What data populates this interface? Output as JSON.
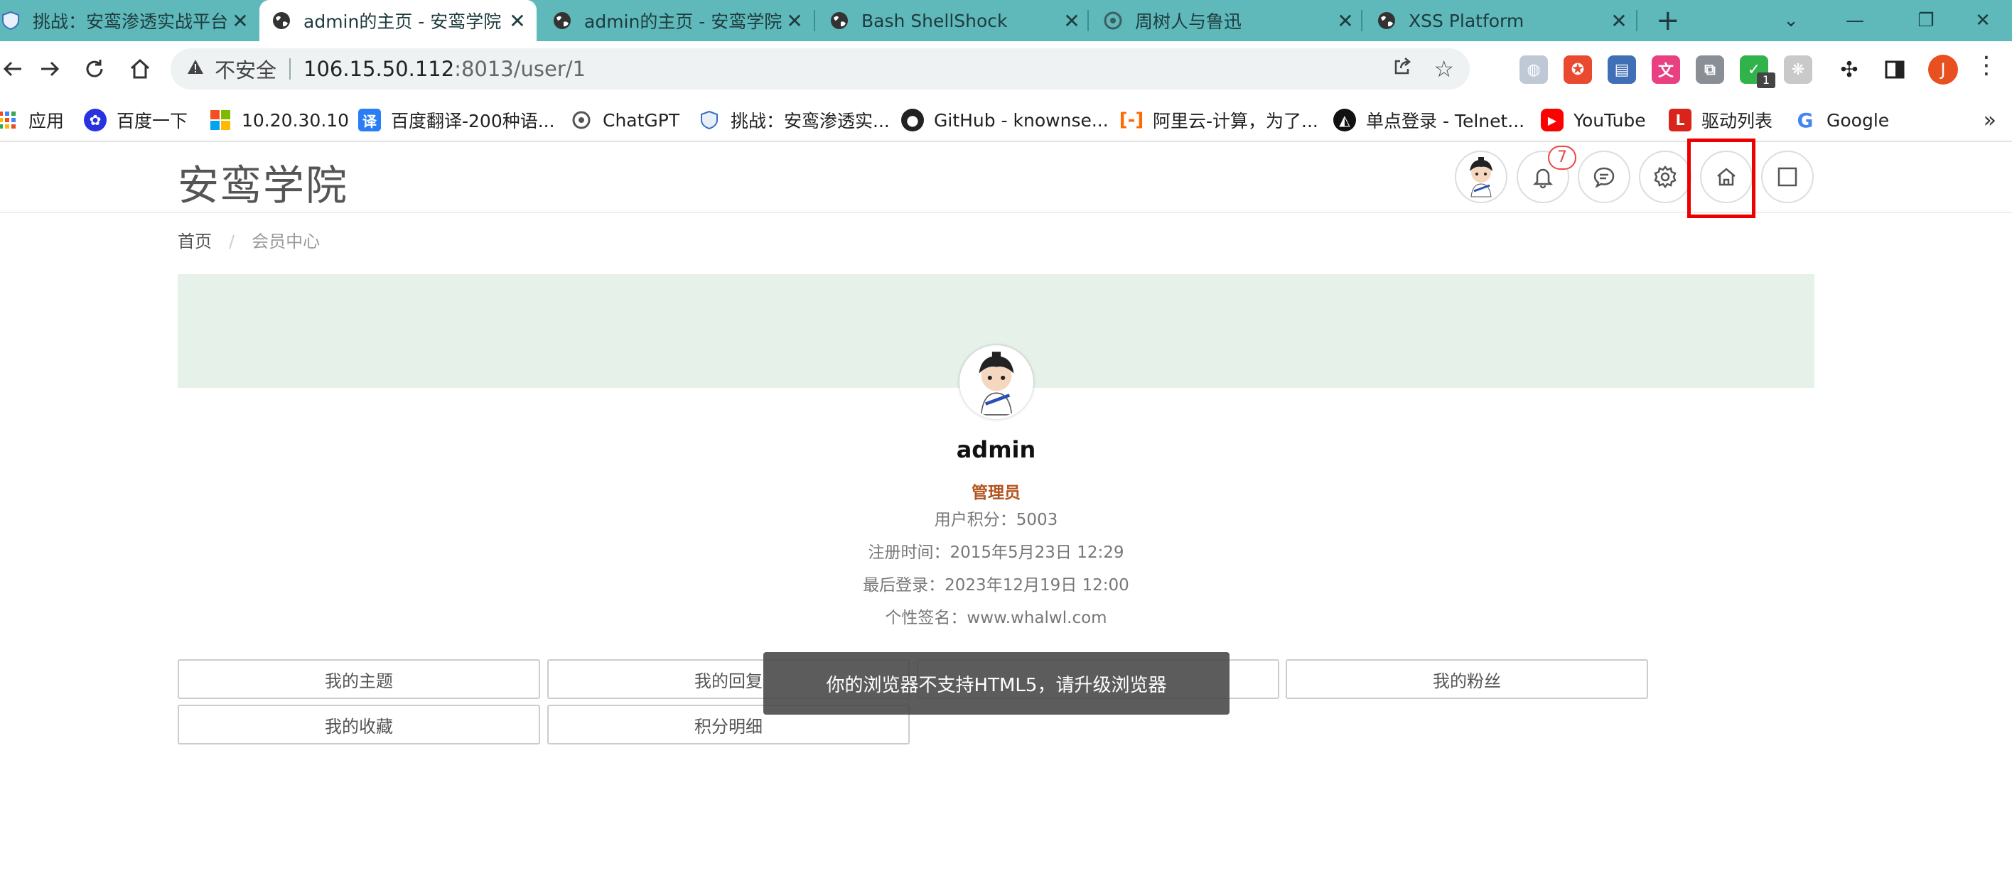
{
  "browser": {
    "tabs": [
      {
        "title": "挑战：安鸾渗透实战平台",
        "active": false,
        "icon": "shield-icon"
      },
      {
        "title": "admin的主页 - 安鸾学院",
        "active": true,
        "icon": "globe-icon"
      },
      {
        "title": "admin的主页 - 安鸾学院",
        "active": false,
        "icon": "globe-icon"
      },
      {
        "title": "Bash ShellShock",
        "active": false,
        "icon": "globe-icon"
      },
      {
        "title": "周树人与鲁迅",
        "active": false,
        "icon": "openai-icon"
      },
      {
        "title": "XSS Platform",
        "active": false,
        "icon": "globe-icon"
      }
    ],
    "address": {
      "security_label": "不安全",
      "host": "106.15.50.112",
      "path": ":8013/user/1"
    },
    "profile_initial": "J",
    "extension_badge": "1",
    "bookmarks": [
      {
        "label": "应用",
        "icon": "apps-grid-icon",
        "color": "#e8501f"
      },
      {
        "label": "百度一下",
        "icon": "baidu-paw-icon",
        "color": "#2932e1"
      },
      {
        "label": "10.20.30.10",
        "icon": "windows-logo-icon",
        "color": "#f25022"
      },
      {
        "label": "百度翻译-200种语...",
        "icon": "translate-icon",
        "color": "#2a7ef5"
      },
      {
        "label": "ChatGPT",
        "icon": "openai-icon",
        "color": "#555555"
      },
      {
        "label": "挑战：安鸾渗透实...",
        "icon": "shield-icon",
        "color": "#3b6fc4"
      },
      {
        "label": "GitHub - knownse...",
        "icon": "github-icon",
        "color": "#222222"
      },
      {
        "label": "阿里云-计算，为了...",
        "icon": "aliyun-icon",
        "color": "#ff6a00"
      },
      {
        "label": "单点登录 - Telnet...",
        "icon": "sso-icon",
        "color": "#111111"
      },
      {
        "label": "YouTube",
        "icon": "youtube-icon",
        "color": "#ff0000"
      },
      {
        "label": "驱动列表",
        "icon": "driver-list-icon",
        "color": "#d9241b"
      },
      {
        "label": "Google",
        "icon": "google-icon",
        "color": "#4285f4"
      }
    ]
  },
  "site": {
    "logo": "安鸾学院",
    "notification_count": "7",
    "breadcrumb": {
      "home": "首页",
      "current": "会员中心"
    }
  },
  "profile": {
    "username": "admin",
    "role": "管理员",
    "points": "用户积分：5003",
    "registered": "注册时间：2015年5月23日 12:29",
    "last_login": "最后登录：2023年12月19日 12:00",
    "signature": "个性签名：www.whalwl.com"
  },
  "buttons": {
    "topics": "我的主题",
    "replies": "我的回复",
    "hidden": "",
    "fans": "我的粉丝",
    "favorites": "我的收藏",
    "points_detail": "积分明细"
  },
  "toast": "你的浏览器不支持HTML5，请升级浏览器"
}
